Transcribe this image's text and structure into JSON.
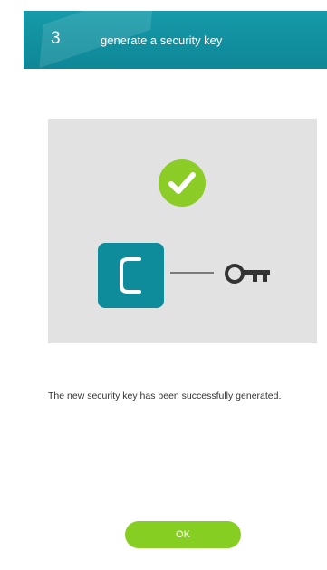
{
  "header": {
    "step_number": "3",
    "title": "generate a security key"
  },
  "illustration": {
    "success_icon": "check-circle-icon",
    "app_icon": "c-logo-icon",
    "key_icon": "key-icon"
  },
  "message": {
    "text": "The new security key has been successfully generated."
  },
  "buttons": {
    "ok_label": "OK"
  },
  "colors": {
    "header": "#1395a5",
    "success": "#8ccc26",
    "logo": "#0f8c9c",
    "button": "#86cf22",
    "panel": "#e2e2e2"
  }
}
